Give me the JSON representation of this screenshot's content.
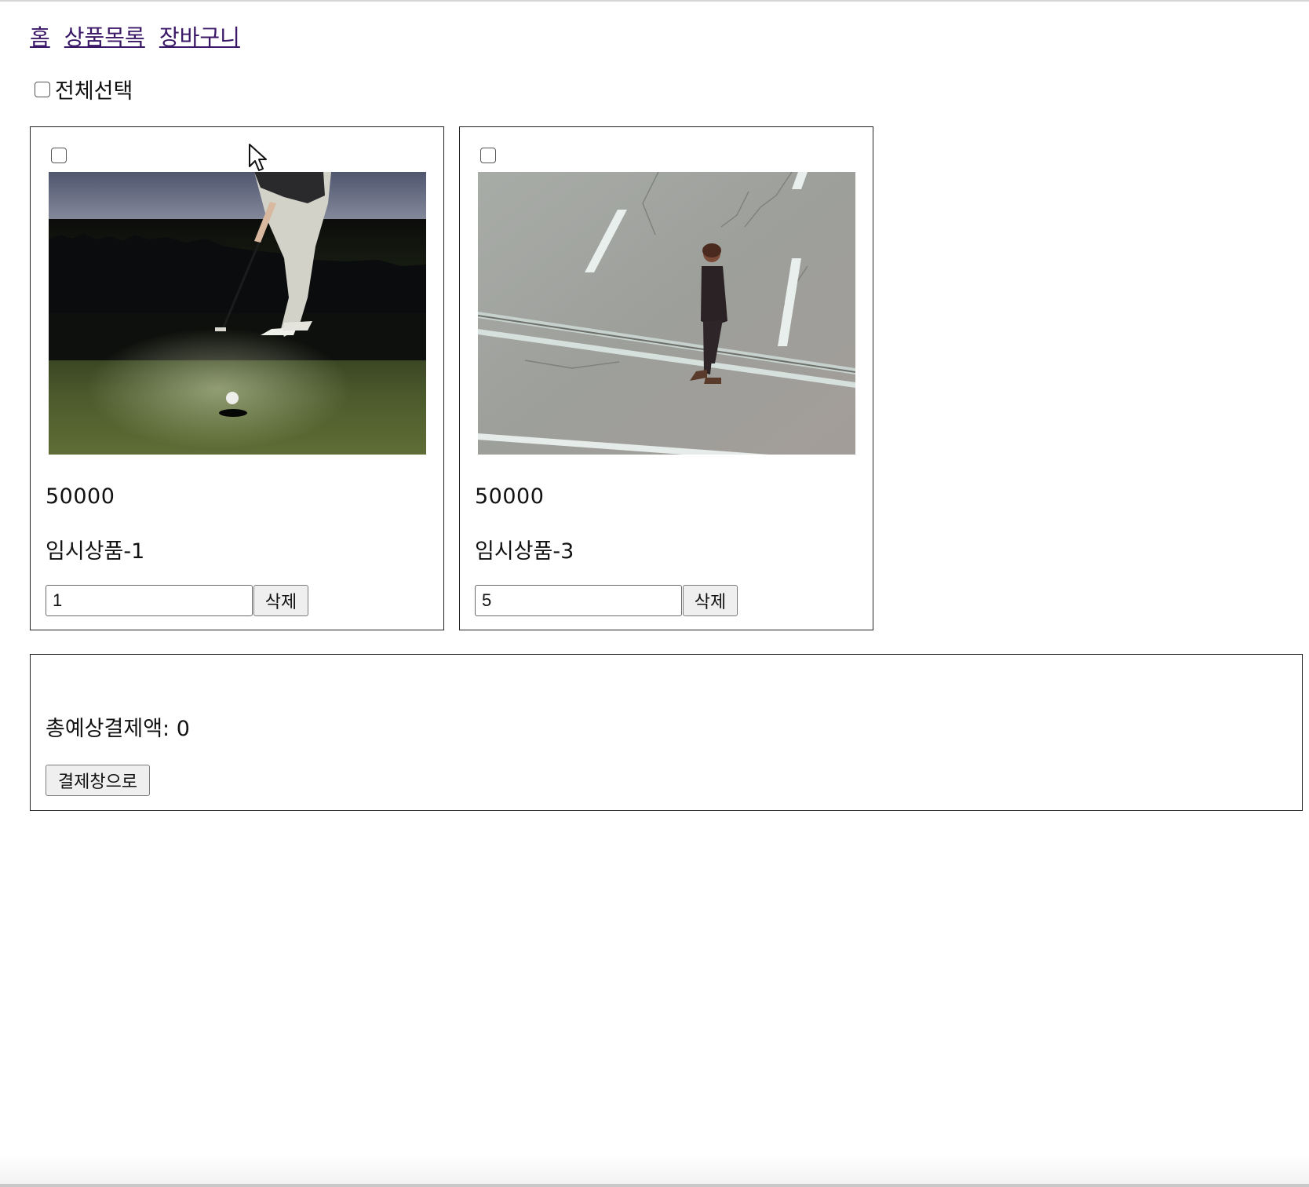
{
  "nav": {
    "links": [
      "홈",
      "상품목록",
      "장바구니"
    ],
    "link_color": "#3b1767"
  },
  "select_all": {
    "label": "전체선택",
    "checked": false
  },
  "cart": {
    "items": [
      {
        "price": "50000",
        "name": "임시상품-1",
        "quantity": "1",
        "delete_label": "삭제",
        "checked": false
      },
      {
        "price": "50000",
        "name": "임시상품-3",
        "quantity": "5",
        "delete_label": "삭제",
        "checked": false
      }
    ]
  },
  "summary": {
    "total_label": "총예상결제액: 0",
    "checkout_label": "결제창으로"
  }
}
